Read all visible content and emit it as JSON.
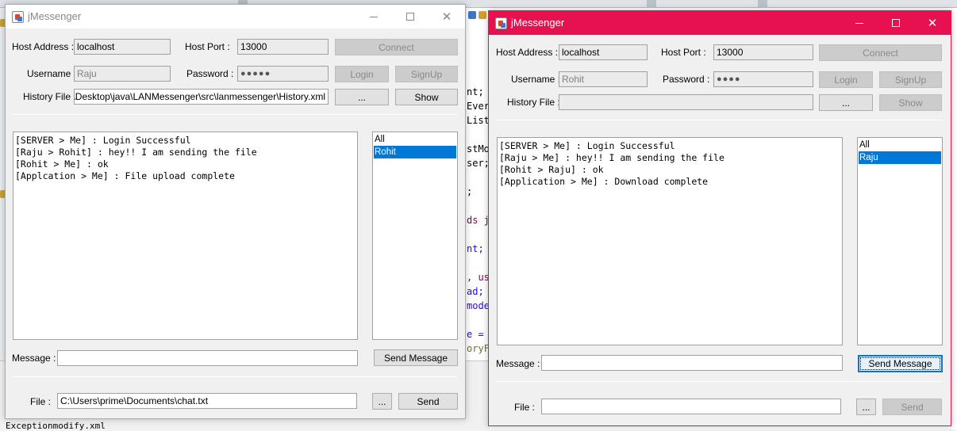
{
  "background_code": {
    "lines": [
      "nt;",
      "Ever",
      "List",
      "stMo",
      "ser;",
      ";",
      "ds j",
      "nt;",
      ", us",
      "ad;",
      "mode",
      "e =",
      "oryF"
    ],
    "bottom_text": "Exceptionmodify.xml"
  },
  "left_window": {
    "title": "jMessenger",
    "host_address_label": "Host Address :",
    "host_address": "localhost",
    "host_port_label": "Host Port :",
    "host_port": "13000",
    "connect_label": "Connect",
    "username_label": "Username :",
    "username": "Raju",
    "password_label": "Password :",
    "password_mask": "●●●●●",
    "login_label": "Login",
    "signup_label": "SignUp",
    "history_label": "History File :",
    "history_path": "prime\\Desktop\\java\\LANMessenger\\src\\lanmessenger\\History.xml",
    "browse_label": "...",
    "show_label": "Show",
    "chat": [
      "[SERVER > Me] : Login Successful",
      "[Raju > Rohit] : hey!! I am sending the file",
      "[Rohit > Me] : ok",
      "[Applcation > Me] : File upload complete"
    ],
    "users": [
      "All",
      "Rohit"
    ],
    "selected_user": "Rohit",
    "message_label": "Message :",
    "message_value": "",
    "send_message_label": "Send Message",
    "file_label": "File :",
    "file_path": "C:\\Users\\prime\\Documents\\chat.txt",
    "file_browse_label": "...",
    "send_label": "Send"
  },
  "right_window": {
    "title": "jMessenger",
    "accent_color": "#e81150",
    "host_address_label": "Host Address :",
    "host_address": "localhost",
    "host_port_label": "Host Port :",
    "host_port": "13000",
    "connect_label": "Connect",
    "username_label": "Username :",
    "username": "Rohit",
    "password_label": "Password :",
    "password_mask": "●●●●",
    "login_label": "Login",
    "signup_label": "SignUp",
    "history_label": "History File :",
    "history_path": "",
    "browse_label": "...",
    "show_label": "Show",
    "chat": [
      "[SERVER > Me] : Login Successful",
      "[Raju > Me] : hey!! I am sending the file",
      "[Rohit > Raju] : ok",
      "[Application > Me] : Download complete"
    ],
    "users": [
      "All",
      "Raju"
    ],
    "selected_user": "Raju",
    "message_label": "Message :",
    "message_value": "",
    "send_message_label": "Send Message",
    "file_label": "File :",
    "file_path": "",
    "file_browse_label": "...",
    "send_label": "Send"
  }
}
